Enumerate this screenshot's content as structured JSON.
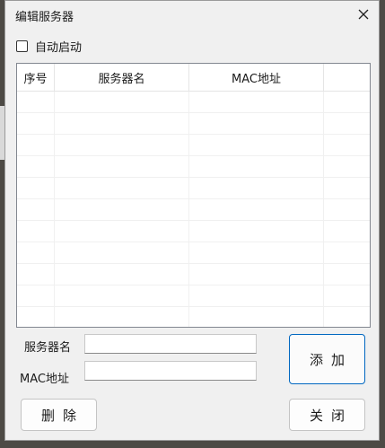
{
  "window": {
    "title": "编辑服务器"
  },
  "options": {
    "autostart_label": "自动启动",
    "autostart_checked": false
  },
  "list": {
    "columns": [
      "序号",
      "服务器名",
      "MAC地址",
      ""
    ],
    "rows": []
  },
  "form": {
    "server_name_label": "服务器名",
    "server_name_value": "",
    "mac_label": "MAC地址",
    "mac_value": ""
  },
  "buttons": {
    "add": "添加",
    "delete": "删除",
    "close": "关闭"
  },
  "icons": {
    "close": "close-icon"
  }
}
